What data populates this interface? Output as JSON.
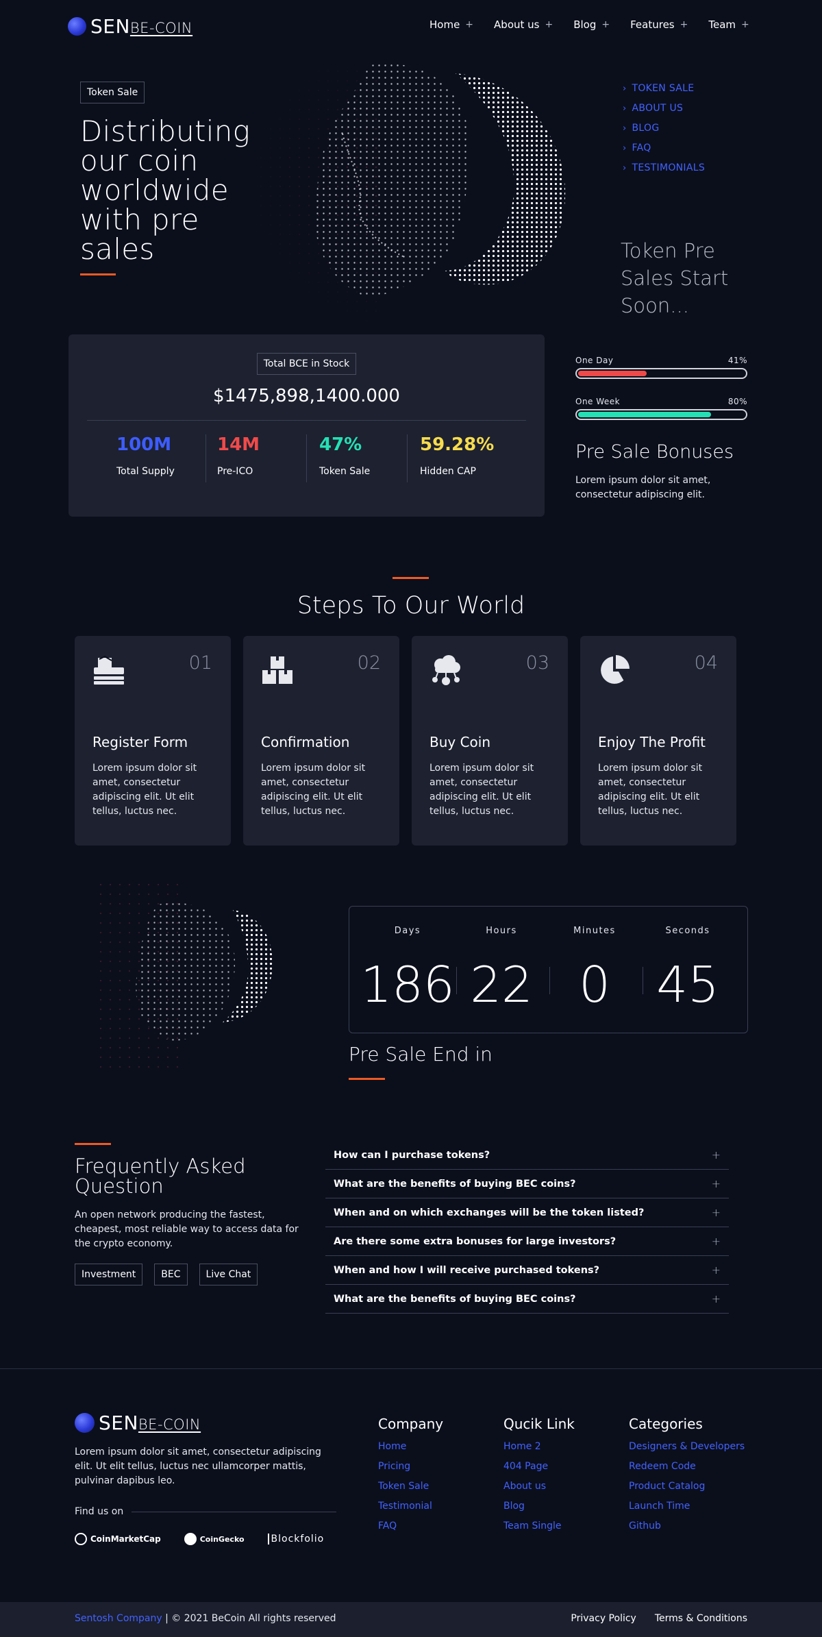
{
  "header": {
    "logo": {
      "main": "SEN",
      "sub": "BE-COIN"
    },
    "nav": [
      {
        "label": "Home"
      },
      {
        "label": "About us"
      },
      {
        "label": "Blog"
      },
      {
        "label": "Features"
      },
      {
        "label": "Team"
      }
    ],
    "nav_plus": "+"
  },
  "hero": {
    "badge": "Token Sale",
    "title_lines": [
      "Distributing",
      "our coin",
      "worldwide",
      "with pre",
      "sales"
    ],
    "side_nav": [
      "TOKEN SALE",
      "ABOUT US",
      "BLOG",
      "FAQ",
      "TESTIMONIALS"
    ],
    "presale_lines": [
      "Token Pre",
      "Sales Start",
      "Soon..."
    ]
  },
  "stock": {
    "badge": "Total BCE in Stock",
    "amount": "$1475,898,1400.000",
    "stats": [
      {
        "value": "100M",
        "label": "Total Supply",
        "color": "#3d5cff"
      },
      {
        "value": "14M",
        "label": "Pre-ICO",
        "color": "#ef4a4a"
      },
      {
        "value": "47%",
        "label": "Token Sale",
        "color": "#25e0b4"
      },
      {
        "value": "59.28%",
        "label": "Hidden CAP",
        "color": "#f7dc4d"
      }
    ]
  },
  "progress": [
    {
      "label": "One Day",
      "percent_text": "41%",
      "value": 0.41,
      "color": "#ef4a4a"
    },
    {
      "label": "One Week",
      "percent_text": "80%",
      "value": 0.8,
      "color": "#25e0b4"
    }
  ],
  "bonuses": {
    "title": "Pre Sale Bonuses",
    "text": "Lorem ipsum dolor sit amet, consectetur adipiscing elit."
  },
  "steps": {
    "title": "Steps To Our World",
    "items": [
      {
        "num": "01",
        "title": "Register Form",
        "icon": "inbox-tray-icon",
        "text": "Lorem ipsum dolor sit amet, consectetur adipiscing elit. Ut elit tellus, luctus nec."
      },
      {
        "num": "02",
        "title": "Confirmation",
        "icon": "boxes-icon",
        "text": "Lorem ipsum dolor sit amet, consectetur adipiscing elit. Ut elit tellus, luctus nec."
      },
      {
        "num": "03",
        "title": "Buy Coin",
        "icon": "cloud-network-icon",
        "text": "Lorem ipsum dolor sit amet, consectetur adipiscing elit. Ut elit tellus, luctus nec."
      },
      {
        "num": "04",
        "title": "Enjoy The Profit",
        "icon": "pie-chart-icon",
        "text": "Lorem ipsum dolor sit amet, consectetur adipiscing elit. Ut elit tellus, luctus nec."
      }
    ]
  },
  "countdown": {
    "units": [
      {
        "label": "Days",
        "value": "186"
      },
      {
        "label": "Hours",
        "value": "22"
      },
      {
        "label": "Minutes",
        "value": "0"
      },
      {
        "label": "Seconds",
        "value": "45"
      }
    ],
    "title": "Pre Sale End in"
  },
  "faq": {
    "title_lines": [
      "Frequently Asked",
      "Question"
    ],
    "text": "An open network producing the fastest, cheapest, most reliable way to access data for the crypto economy.",
    "tags": [
      "Investment",
      "BEC",
      "Live Chat"
    ],
    "questions": [
      "How can I purchase tokens?",
      "What are the benefits of buying BEC coins?",
      "When and on which exchanges will be the token listed?",
      "Are there some extra bonuses for large investors?",
      "When and how I will receive purchased tokens?",
      "What are the benefits of buying BEC coins?"
    ],
    "plus": "+"
  },
  "footer": {
    "about": "Lorem ipsum dolor sit amet, consectetur adipiscing elit. Ut elit tellus, luctus nec ullamcorper mattis, pulvinar dapibus leo.",
    "find_us": "Find us on",
    "partners": [
      "CoinMarketCap",
      "CoinGecko",
      "Blockfolio"
    ],
    "columns": [
      {
        "title": "Company",
        "links": [
          "Home",
          "Pricing",
          "Token Sale",
          "Testimonial",
          "FAQ"
        ]
      },
      {
        "title": "Qucik Link",
        "links": [
          "Home 2",
          "404 Page",
          "About us",
          "Blog",
          "Team Single"
        ]
      },
      {
        "title": "Categories",
        "links": [
          "Designers & Developers",
          "Redeem Code",
          "Product Catalog",
          "Launch Time",
          "Github"
        ]
      }
    ],
    "copyright_link": "Sentosh Company",
    "copyright_text": " | © 2021 BeCoin All rights reserved",
    "bottom_links": [
      "Privacy Policy",
      "Terms & Conditions"
    ]
  },
  "colors": {
    "background": "#0b0f1c",
    "card": "#1d2130",
    "accent_blue": "#4362ff",
    "accent_orange": "#ee5a24"
  }
}
